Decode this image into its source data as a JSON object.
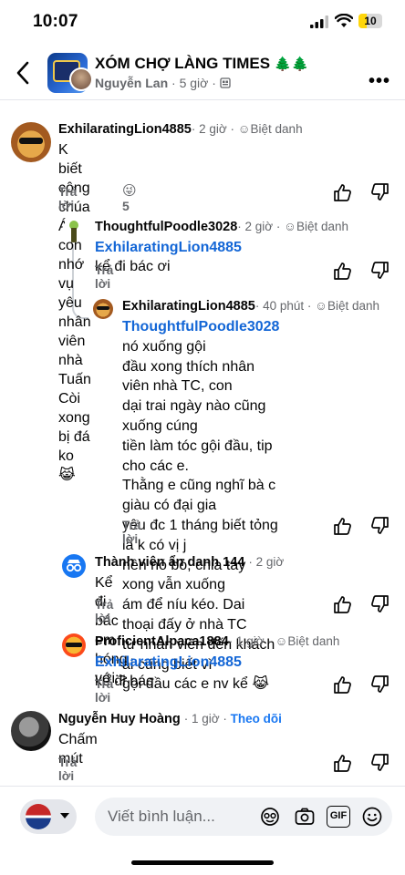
{
  "status_bar": {
    "time": "10:07",
    "battery": "10"
  },
  "header": {
    "group_name": "XÓM CHỢ LÀNG TIMES",
    "group_decoration": "🌲🌲",
    "poster_name": "Nguyễn Lan",
    "post_age": "5 giờ",
    "audience_icon": "group-audience-icon"
  },
  "comments": [
    {
      "author": "ExhilaratingLion4885",
      "meta": "· 2 giờ · ",
      "badge": "Biệt danh",
      "line1": "K biết công chúa Ánh còn nhớ vụ yêu nhân viên",
      "line2": "nhà Tuấn Còi xong bị đá ko 😹",
      "reply": "Trả lời",
      "reaction_emoji": "😜",
      "reaction_count": "5"
    },
    {
      "author": "ThoughtfulPoodle3028",
      "meta": "· 2 giờ · ",
      "badge": "Biệt danh",
      "mention": "ExhilaratingLion4885",
      "text": " kể đi bác ơi",
      "reply": "Trả lời"
    },
    {
      "author": "ExhilaratingLion4885",
      "meta": "· 40 phút · ",
      "badge": "Biệt danh",
      "mention": "ThoughtfulPoodle3028",
      "line1": " nó xuống gội",
      "line2": "đầu xong thích nhân viên nhà TC, con",
      "line3": "dại trai ngày nào cũng xuống cúng",
      "line4": "tiền làm tóc gội đầu, tip cho các e.",
      "line5": "Thằng e cũng nghĩ bà c giàu có đại gia",
      "line6": "yêu đc 1 tháng biết tỏng là k có vị j",
      "line7": "nên nó bỏ, chia tay xong vẫn xuống",
      "line8": "ám để níu kéo. Dai thoại đấy ở nhà TC",
      "line9": "từ nhân viên đến khách ai cũng biết vì",
      "line10": "gội đầu các e nv kể 😹",
      "reply": "Trả lời"
    },
    {
      "author": "Thành viên ẩn danh 144",
      "meta": "· 2 giờ",
      "text": "Kể đi bác em hóng với:>",
      "reply": "Trả lời"
    },
    {
      "author": "ProficientAlpaca1884",
      "meta": "· 1 giờ · ",
      "badge": "Biệt danh",
      "mention": "ExhilaratingLion4885",
      "text": " kể đi bác",
      "reply": "Trả lời"
    },
    {
      "author": "Nguyễn Huy Hoàng",
      "meta": "· 1 giờ · ",
      "follow": "Theo dõi",
      "text": "Chấm mút",
      "reply": "Trả lời"
    }
  ],
  "composer": {
    "placeholder": "Viết bình luận...",
    "gif_label": "GIF"
  }
}
